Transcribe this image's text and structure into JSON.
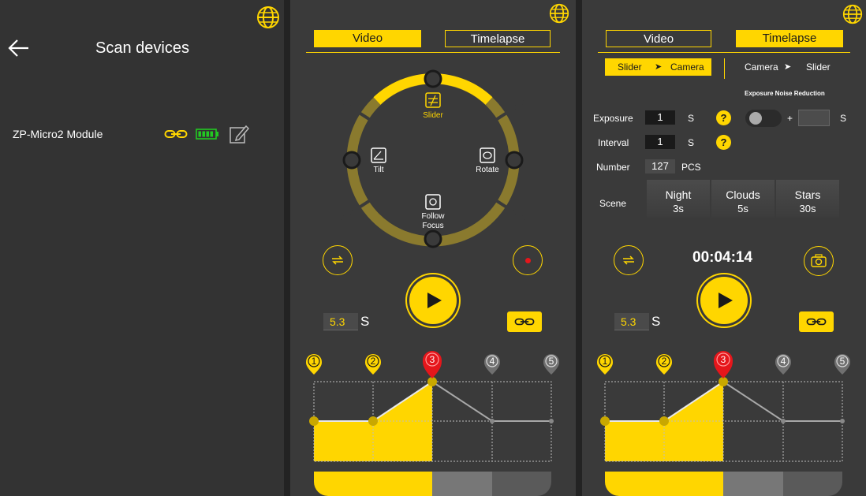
{
  "scan": {
    "title": "Scan devices",
    "device_name": "ZP-Micro2 Module"
  },
  "video": {
    "tab_video": "Video",
    "tab_timelapse": "Timelapse",
    "modes": {
      "slider": "Slider",
      "tilt": "Tilt",
      "rotate": "Rotate",
      "follow_focus_1": "Follow",
      "follow_focus_2": "Focus"
    },
    "duration": "5.3",
    "duration_unit": "S",
    "keyframes": [
      "1",
      "2",
      "3",
      "4",
      "5"
    ]
  },
  "timelapse": {
    "tab_video": "Video",
    "tab_timelapse": "Timelapse",
    "order_slider_camera": {
      "a": "Slider",
      "b": "Camera"
    },
    "order_camera_slider": {
      "a": "Camera",
      "b": "Slider"
    },
    "noise_reduction_label": "Exposure Noise Reduction",
    "exposure": {
      "label": "Exposure",
      "value": "1",
      "unit": "S"
    },
    "interval": {
      "label": "Interval",
      "value": "1",
      "unit": "S"
    },
    "number": {
      "label": "Number",
      "value": "127",
      "unit": "PCS"
    },
    "nr_plus": "+",
    "nr_unit": "S",
    "scene_label": "Scene",
    "scenes": [
      {
        "name": "Night",
        "time": "3s"
      },
      {
        "name": "Clouds",
        "time": "5s"
      },
      {
        "name": "Stars",
        "time": "30s"
      }
    ],
    "timer": "00:04:14",
    "duration": "5.3",
    "duration_unit": "S",
    "keyframes": [
      "1",
      "2",
      "3",
      "4",
      "5"
    ]
  },
  "colors": {
    "accent": "#ffd600",
    "panel": "#3a3a3a",
    "active_keyframe": "#e5161b",
    "inactive_keyframe": "#707070",
    "battery": "#22c922"
  },
  "icons": [
    "back-arrow-icon",
    "globe-icon",
    "link-icon",
    "battery-icon",
    "edit-icon",
    "loop-icon",
    "record-icon",
    "play-icon",
    "camera-icon",
    "help-icon"
  ]
}
